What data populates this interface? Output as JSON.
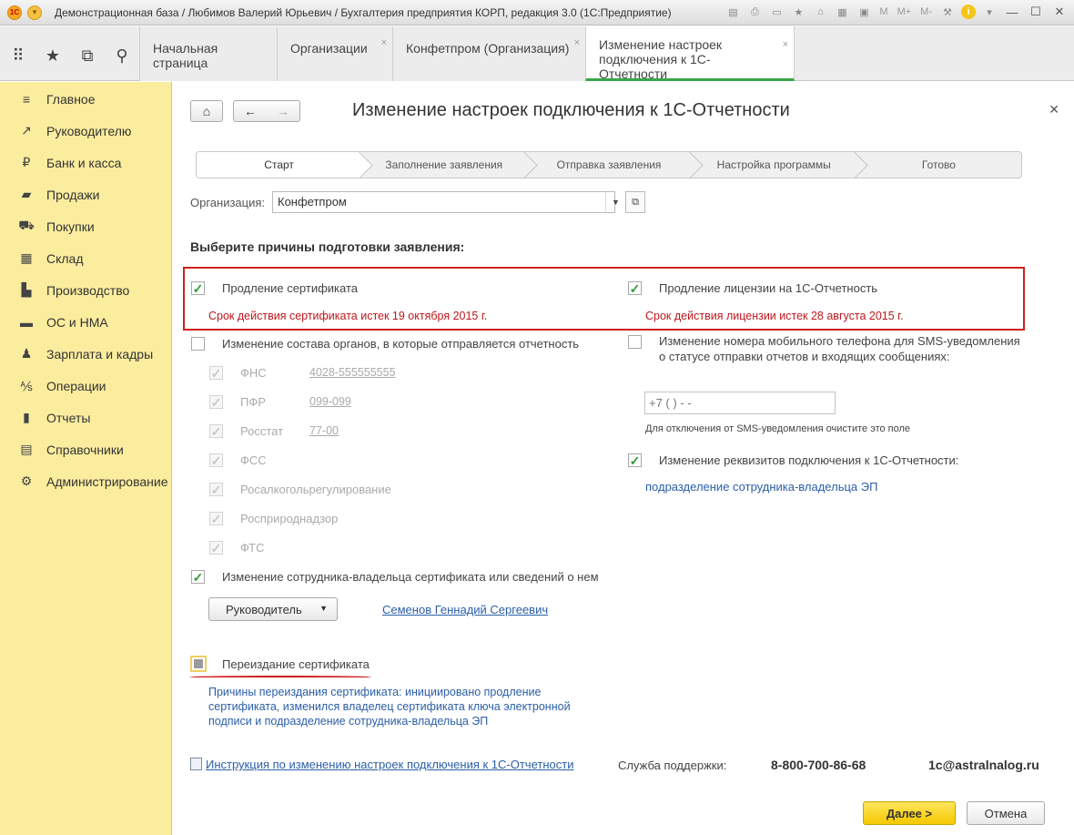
{
  "window": {
    "title": "Демонстрационная база / Любимов Валерий Юрьевич / Бухгалтерия предприятия КОРП, редакция 3.0  (1С:Предприятие)",
    "logo_text": "1С",
    "tools": [
      "M",
      "M+",
      "M-"
    ]
  },
  "tabs": [
    {
      "label": "Начальная страница",
      "closable": false
    },
    {
      "label": "Организации",
      "closable": true
    },
    {
      "label": "Конфетпром (Организация)",
      "closable": true
    },
    {
      "label": "Изменение настроек подключения к 1С-Отчетности",
      "closable": true,
      "active": true
    }
  ],
  "sidebar": {
    "items": [
      {
        "label": "Главное",
        "icon": "menu-icon"
      },
      {
        "label": "Руководителю",
        "icon": "trend-icon"
      },
      {
        "label": "Банк и касса",
        "icon": "ruble-icon"
      },
      {
        "label": "Продажи",
        "icon": "bag-icon"
      },
      {
        "label": "Покупки",
        "icon": "cart-icon"
      },
      {
        "label": "Склад",
        "icon": "warehouse-icon"
      },
      {
        "label": "Производство",
        "icon": "factory-icon"
      },
      {
        "label": "ОС и НМА",
        "icon": "truck-icon"
      },
      {
        "label": "Зарплата и кадры",
        "icon": "people-icon"
      },
      {
        "label": "Операции",
        "icon": "operations-icon"
      },
      {
        "label": "Отчеты",
        "icon": "chart-icon"
      },
      {
        "label": "Справочники",
        "icon": "book-icon"
      },
      {
        "label": "Администрирование",
        "icon": "gear-icon"
      }
    ]
  },
  "page": {
    "title": "Изменение настроек подключения к 1С-Отчетности",
    "steps": [
      "Старт",
      "Заполнение заявления",
      "Отправка заявления",
      "Настройка программы",
      "Готово"
    ],
    "org_label": "Организация:",
    "org_value": "Конфетпром",
    "section_title": "Выберите причины подготовки заявления:",
    "cert_renewal": {
      "label": "Продление сертификата",
      "checked": true,
      "note": "Срок действия сертификата истек 19 октября 2015 г."
    },
    "license_renewal": {
      "label": "Продление лицензии на 1С-Отчетность",
      "checked": true,
      "note": "Срок действия лицензии истек 28 августа 2015 г."
    },
    "agencies_change": {
      "label": "Изменение состава органов, в которые отправляется отчетность",
      "checked": false,
      "agencies": [
        {
          "name": "ФНС",
          "code": "4028-555555555"
        },
        {
          "name": "ПФР",
          "code": "099-099"
        },
        {
          "name": "Росстат",
          "code": "77-00"
        },
        {
          "name": "ФСС",
          "code": ""
        },
        {
          "name": "Росалкогольрегулирование",
          "code": ""
        },
        {
          "name": "Росприроднадзор",
          "code": ""
        },
        {
          "name": "ФТС",
          "code": ""
        }
      ]
    },
    "phone_change": {
      "line1": "Изменение номера мобильного телефона для SMS-уведомления",
      "line2": "о статусе отправки отчетов и входящих сообщениях:",
      "checked": false,
      "phone_value": "+7 (   )    -  -",
      "hint": "Для отключения от SMS-уведомления очистите это поле"
    },
    "details_change": {
      "label": "Изменение реквизитов подключения к 1С-Отчетности:",
      "checked": true,
      "link": "подразделение сотрудника-владельца ЭП"
    },
    "owner_change": {
      "label": "Изменение сотрудника-владельца сертификата или сведений о нем",
      "checked": true,
      "role": "Руководитель",
      "person": "Семенов Геннадий Сергеевич"
    },
    "reissue": {
      "label": "Переиздание сертификата",
      "reason": "Причины переиздания сертификата: инициировано продление сертификата, изменился владелец сертификата ключа электронной подписи и подразделение сотрудника-владельца ЭП"
    },
    "instruction_link": "Инструкция по изменению настроек подключения к 1С-Отчетности",
    "support_label": "Служба поддержки:",
    "support_phone": "8-800-700-86-68",
    "support_email": "1c@astralnalog.ru",
    "next_label": "Далее  >",
    "cancel_label": "Отмена"
  },
  "colors": {
    "sidebar_bg": "#fbed9e",
    "accent_red": "#d0201c",
    "link_blue": "#2b5ea8",
    "check_green": "#2e9a3c",
    "next_button": "#f5c800"
  }
}
